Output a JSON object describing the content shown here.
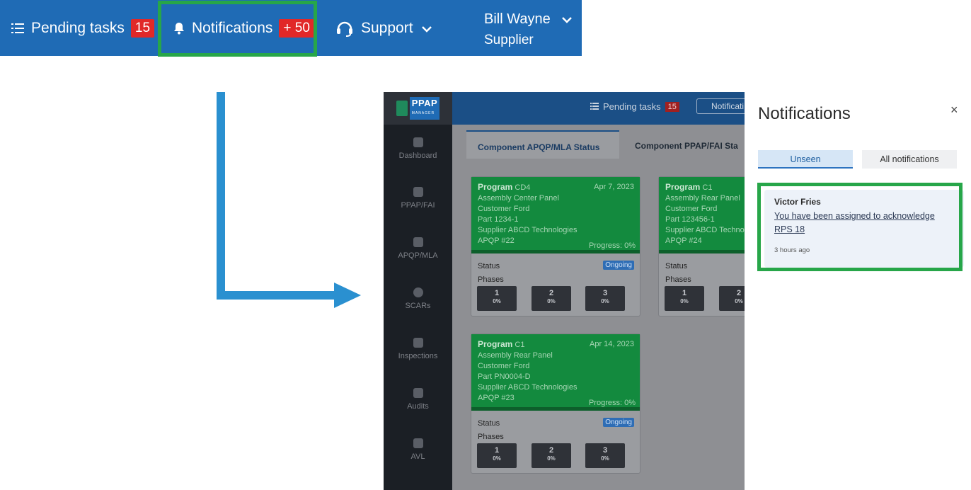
{
  "topbar": {
    "pending_label": "Pending tasks",
    "pending_count": "15",
    "notifications_label": "Notifications",
    "notifications_count": "+ 50",
    "support_label": "Support",
    "user_name": "Bill Wayne",
    "user_role": "Supplier"
  },
  "app": {
    "logo_text": "PPAP",
    "logo_sub": "MANAGER",
    "sidebar": [
      "Dashboard",
      "PPAP/FAI",
      "APQP/MLA",
      "SCARs",
      "Inspections",
      "Audits",
      "AVL"
    ],
    "header": {
      "pending_label": "Pending tasks",
      "pending_count": "15",
      "notifications_label": "Notificati"
    },
    "tabs": [
      "Component APQP/MLA Status",
      "Component PPAP/FAI Sta"
    ],
    "cards": [
      {
        "program_label": "Program",
        "program": "CD4",
        "date": "Apr 7, 2023",
        "assembly": "Assembly Center Panel",
        "customer": "Customer Ford",
        "part": "Part 1234-1",
        "supplier": "Supplier ABCD Technologies",
        "apqp": "APQP #22",
        "progress": "Progress: 0%",
        "status_label": "Status",
        "status": "Ongoing",
        "phases_label": "Phases",
        "phases": [
          {
            "n": "1",
            "p": "0%"
          },
          {
            "n": "2",
            "p": "0%"
          },
          {
            "n": "3",
            "p": "0%"
          }
        ]
      },
      {
        "program_label": "Program",
        "program": "C1",
        "date": "",
        "assembly": "Assembly Rear Panel",
        "customer": "Customer Ford",
        "part": "Part 123456-1",
        "supplier": "Supplier ABCD Technolo",
        "apqp": "APQP #24",
        "progress": "",
        "status_label": "Status",
        "status": "",
        "phases_label": "Phases",
        "phases": [
          {
            "n": "1",
            "p": "0%"
          },
          {
            "n": "2",
            "p": "0%"
          }
        ]
      },
      {
        "program_label": "Program",
        "program": "C1",
        "date": "Apr 14, 2023",
        "assembly": "Assembly Rear Panel",
        "customer": "Customer Ford",
        "part": "Part PN0004-D",
        "supplier": "Supplier ABCD Technologies",
        "apqp": "APQP #23",
        "progress": "Progress: 0%",
        "status_label": "Status",
        "status": "Ongoing",
        "phases_label": "Phases",
        "phases": [
          {
            "n": "1",
            "p": "0%"
          },
          {
            "n": "2",
            "p": "0%"
          },
          {
            "n": "3",
            "p": "0%"
          }
        ]
      }
    ]
  },
  "notifications": {
    "title": "Notifications",
    "close": "×",
    "tab_unseen": "Unseen",
    "tab_all": "All notifications",
    "item": {
      "sender": "Victor Fries",
      "message": "You have been assigned to acknowledge RPS 18",
      "time": "3 hours ago"
    }
  },
  "colors": {
    "topbar_bg": "#1f6bb5",
    "badge_red": "#e12828",
    "highlight_green": "#27a649",
    "arrow_blue": "#2a90d0",
    "card_green": "#138a3e"
  }
}
